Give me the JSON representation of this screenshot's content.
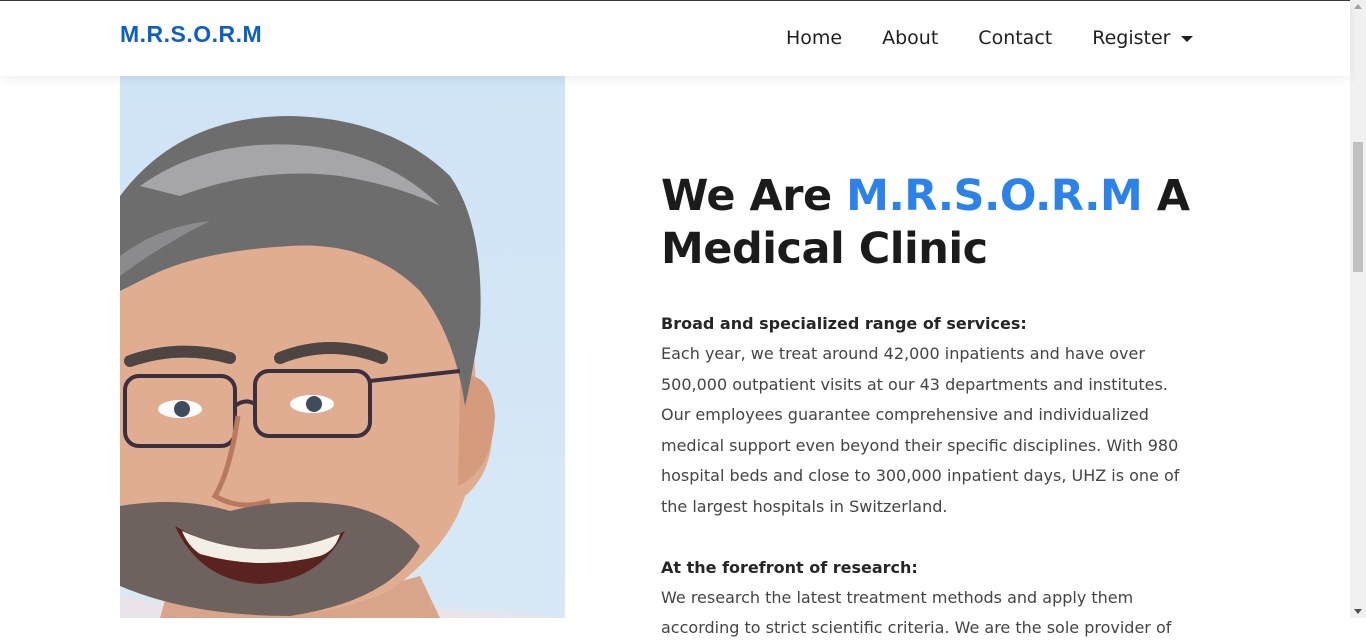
{
  "brand": {
    "name": "M.R.S.O.R.M",
    "color": "#0d5fc4"
  },
  "nav": {
    "items": [
      {
        "label": "Home"
      },
      {
        "label": "About"
      },
      {
        "label": "Contact"
      },
      {
        "label": "Register",
        "icon": "caret-down-icon"
      }
    ]
  },
  "hero": {
    "photo": "doctor-portrait",
    "heading_prefix": "We Are ",
    "heading_highlight": "M.R.S.O.R.M",
    "heading_suffix": " A Medical Clinic",
    "highlight_color": "#2b82ea",
    "sections": [
      {
        "title": "Broad and specialized range of services:",
        "body": "Each year, we treat around 42,000 inpatients and have over 500,000 outpatient visits at our 43 departments and institutes. Our employees guarantee comprehensive and individualized medical support even beyond their specific disciplines. With 980 hospital beds and close to 300,000 inpatient days, UHZ is one of the largest hospitals in Switzerland."
      },
      {
        "title": "At the forefront of research:",
        "body": "We research the latest treatment methods and apply them according to strict scientific criteria. We are the sole provider of"
      }
    ]
  }
}
